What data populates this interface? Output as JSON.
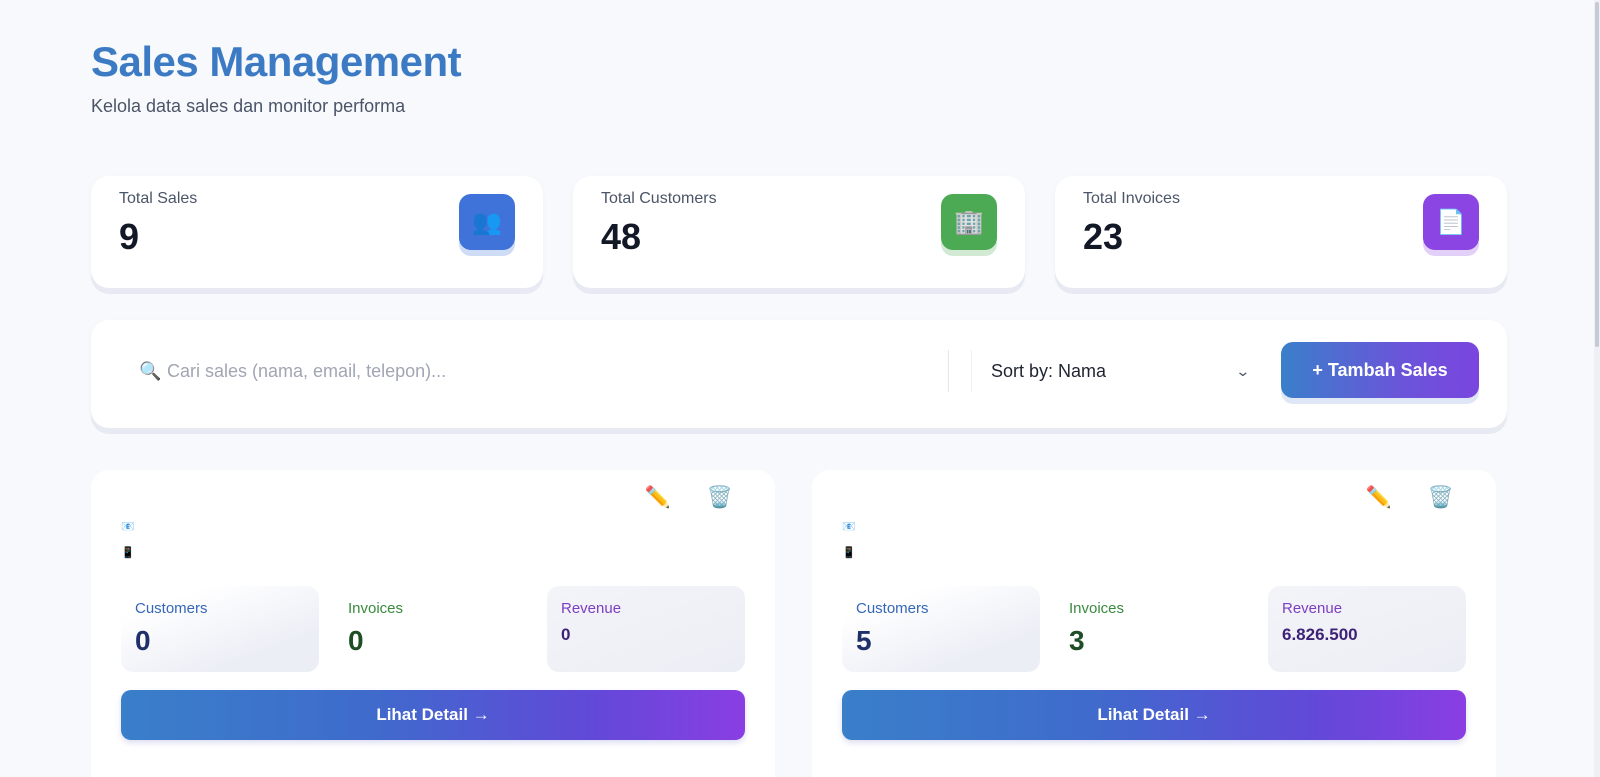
{
  "header": {
    "title": "Sales Management",
    "subtitle": "Kelola data sales dan monitor performa"
  },
  "stats": [
    {
      "label": "Total Sales",
      "value": "9",
      "icon": "users-icon",
      "glyph": "👥",
      "color": "#3f73d9"
    },
    {
      "label": "Total Customers",
      "value": "48",
      "icon": "building-icon",
      "glyph": "🏢",
      "color": "#4caa55"
    },
    {
      "label": "Total Invoices",
      "value": "23",
      "icon": "document-icon",
      "glyph": "📄",
      "color": "#8b45e3"
    }
  ],
  "toolbar": {
    "search_icon": "🔍",
    "search_placeholder": "Cari sales (nama, email, telepon)...",
    "search_value": "",
    "sort_label": "Sort by: Nama",
    "add_label": "+ Tambah Sales"
  },
  "sales_cards": [
    {
      "email_icon": "📧",
      "phone_icon": "📱",
      "edit_icon": "✏️",
      "delete_icon": "🗑️",
      "customers_label": "Customers",
      "customers_value": "0",
      "invoices_label": "Invoices",
      "invoices_value": "0",
      "revenue_label": "Revenue",
      "revenue_value": "0",
      "detail_label": "Lihat Detail →"
    },
    {
      "email_icon": "📧",
      "phone_icon": "📱",
      "edit_icon": "✏️",
      "delete_icon": "🗑️",
      "customers_label": "Customers",
      "customers_value": "5",
      "invoices_label": "Invoices",
      "invoices_value": "3",
      "revenue_label": "Revenue",
      "revenue_value": "6.826.500",
      "detail_label": "Lihat Detail →"
    }
  ],
  "colors": {
    "title": "#3c7bc4",
    "accent_start": "#3a7fca",
    "accent_end": "#8a3ee3"
  }
}
